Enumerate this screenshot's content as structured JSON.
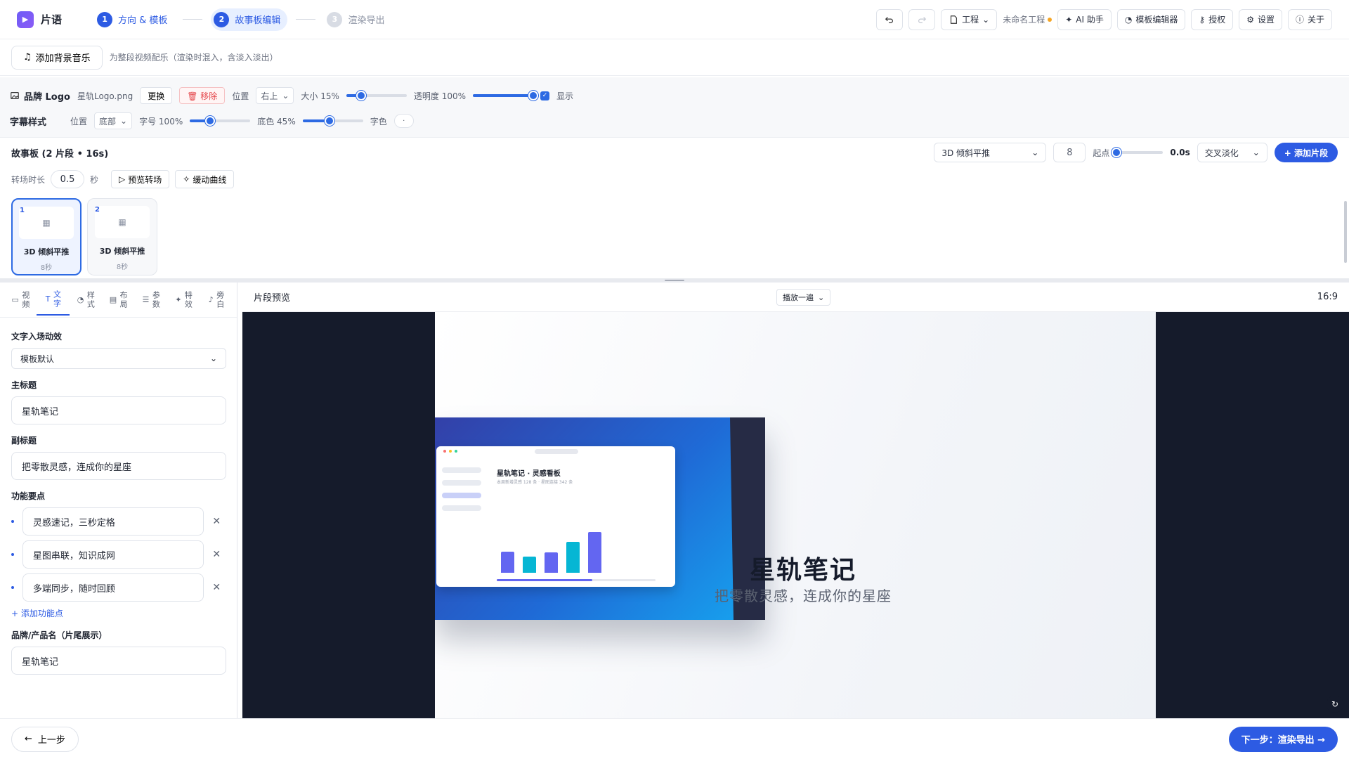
{
  "app": {
    "name": "片语"
  },
  "steps": [
    {
      "num": "1",
      "label": "方向 & 模板",
      "state": "done"
    },
    {
      "num": "2",
      "label": "故事板编辑",
      "state": "active"
    },
    {
      "num": "3",
      "label": "渲染导出",
      "state": "pending"
    }
  ],
  "toolbar": {
    "project_menu": "工程",
    "project_name": "未命名工程",
    "ai_assistant": "AI 助手",
    "template_editor": "模板编辑器",
    "license": "授权",
    "settings": "设置",
    "about": "关于"
  },
  "music": {
    "button": "添加背景音乐",
    "hint": "为整段视频配乐（渲染时混入，含淡入淡出）"
  },
  "logo": {
    "label": "品牌 Logo",
    "file": "星轨Logo.png",
    "replace": "更换",
    "remove": "移除",
    "position_label": "位置",
    "position": "右上",
    "size_label": "大小 15%",
    "size": 15,
    "opacity_label": "透明度 100%",
    "opacity": 100,
    "show_label": "显示",
    "show": true
  },
  "subtitle_style": {
    "label": "字幕样式",
    "position_label": "位置",
    "position": "底部",
    "font_size_label": "字号 100%",
    "font_size": 100,
    "bg_label": "底色 45%",
    "bg": 45,
    "color_label": "字色",
    "color_value": "·"
  },
  "storyboard": {
    "title": "故事板 (2 片段 • 16s)",
    "template_select": "3D 倾斜平推",
    "count": "8",
    "start_label": "起点",
    "start_value": "0.0s",
    "transition_select": "交叉淡化",
    "add_clip": "+ 添加片段",
    "trans_label": "转场时长",
    "trans_value": "0.5",
    "trans_unit": "秒",
    "preview_trans": "预览转场",
    "easing": "缓动曲线",
    "clips": [
      {
        "index": "1",
        "name": "3D 倾斜平推",
        "duration": "8秒"
      },
      {
        "index": "2",
        "name": "3D 倾斜平推",
        "duration": "8秒"
      }
    ]
  },
  "tabs": [
    {
      "label": "视频",
      "icon": "video-icon"
    },
    {
      "label": "文字",
      "icon": "text-icon"
    },
    {
      "label": "样式",
      "icon": "palette-icon"
    },
    {
      "label": "布局",
      "icon": "layout-icon"
    },
    {
      "label": "参数",
      "icon": "sliders-icon"
    },
    {
      "label": "特效",
      "icon": "sparkle-icon"
    },
    {
      "label": "旁白",
      "icon": "mic-icon"
    }
  ],
  "form": {
    "anim_label": "文字入场动效",
    "anim_value": "模板默认",
    "title_label": "主标题",
    "title_value": "星轨笔记",
    "subtitle_label": "副标题",
    "subtitle_value": "把零散灵感，连成你的星座",
    "features_label": "功能要点",
    "features": [
      "灵感速记，三秒定格",
      "星图串联，知识成网",
      "多端同步，随时回顾"
    ],
    "add_feature": "+ 添加功能点",
    "brand_label": "品牌/产品名（片尾展示）",
    "brand_value": "星轨笔记"
  },
  "preview": {
    "title": "片段预览",
    "mode": "播放一遍",
    "ratio": "16:9",
    "window_title": "星轨笔记 · 灵感看板",
    "window_sub": "本周新增灵感 128 条 · 星图连接 342 条",
    "bar_values": [
      4.2,
      3.2,
      4.0,
      6.0,
      8.0
    ],
    "bar_colors": [
      "#6366f1",
      "#06b6d4",
      "#6366f1",
      "#06b6d4",
      "#6366f1"
    ],
    "big_title": "星轨笔记",
    "big_subtitle": "把零散灵感，连成你的星座"
  },
  "footer": {
    "prev": "上一步",
    "next": "下一步：渲染导出 →"
  }
}
